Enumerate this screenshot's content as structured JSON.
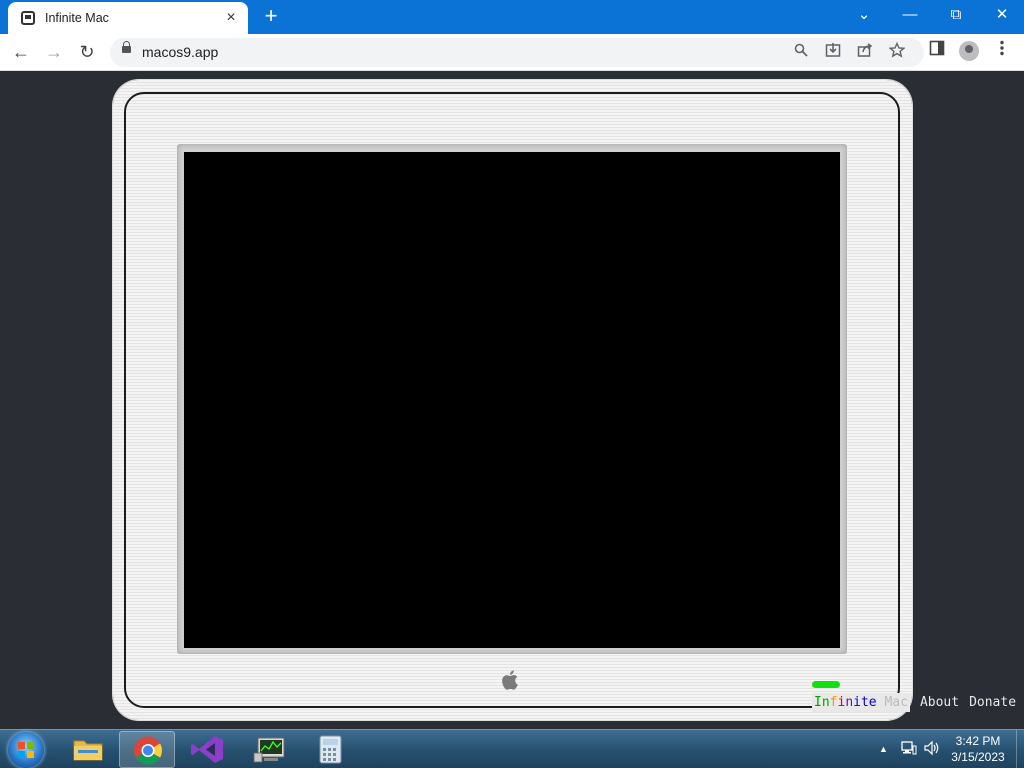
{
  "browser": {
    "tab_title": "Infinite Mac",
    "tab_close_icon": "×",
    "new_tab_icon": "+",
    "url": "macos9.app",
    "window_controls": {
      "tab_search": "⌄",
      "minimize": "—",
      "restore": "⧉",
      "close": "✕"
    },
    "nav": {
      "back": "←",
      "forward": "→",
      "reload": "↻"
    }
  },
  "page": {
    "footer_brand_letters": [
      "I",
      "n",
      "f",
      "i",
      "n",
      "i",
      "t",
      "e",
      " ",
      "M",
      "a",
      "c"
    ],
    "footer_brand_colors": [
      "#00a000",
      "#00a000",
      "#e8a000",
      "#e00000",
      "#8000c0",
      "#0000e0",
      "#0000e0",
      "#0000e0",
      "#bbbbbb",
      "#bbbbbb",
      "#bbbbbb",
      "#bbbbbb"
    ],
    "about_label": "About",
    "donate_label": "Donate"
  },
  "taskbar": {
    "apps": [
      "file-explorer",
      "chrome",
      "visual-studio",
      "system-monitor",
      "calculator"
    ],
    "clock_time": "3:42 PM",
    "clock_date": "3/15/2023",
    "tray_chevron": "▲"
  },
  "colors": {
    "chrome_accent": "#0b73d6",
    "page_background": "#2a2d33",
    "power_led": "#10e010"
  }
}
